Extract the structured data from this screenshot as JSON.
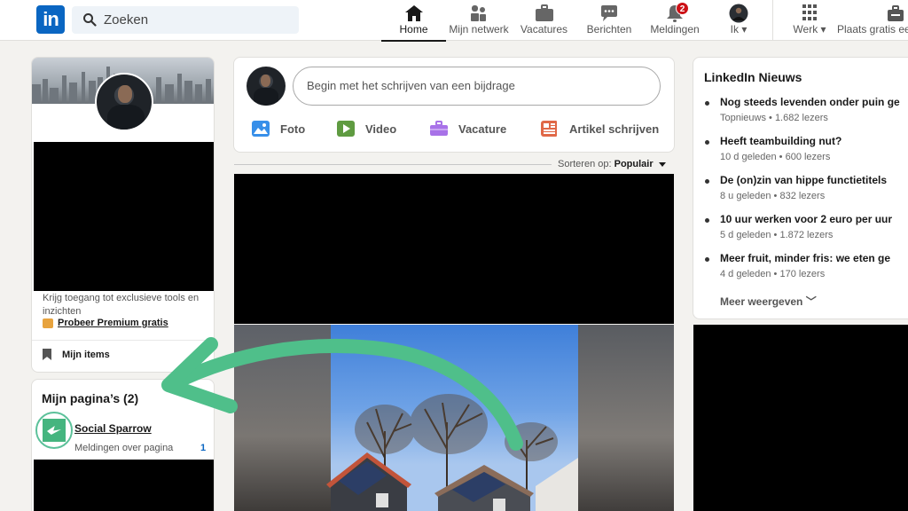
{
  "topbar": {
    "logo": "in",
    "search_placeholder": "Zoeken",
    "nav": [
      {
        "label": "Home",
        "icon": "home-icon"
      },
      {
        "label": "Mijn netwerk",
        "icon": "network-icon"
      },
      {
        "label": "Vacatures",
        "icon": "briefcase-icon"
      },
      {
        "label": "Berichten",
        "icon": "messaging-icon"
      },
      {
        "label": "Meldingen",
        "icon": "bell-icon"
      },
      {
        "label": "Ik",
        "icon": "me-avatar"
      },
      {
        "label": "Werk",
        "icon": "grid-icon"
      },
      {
        "label": "Plaats gratis ee",
        "icon": "job-post-icon"
      }
    ],
    "notifications_count": "2"
  },
  "profile": {
    "premium_text": "Krijg toegang tot exclusieve tools en inzichten",
    "premium_link": "Probeer Premium gratis",
    "my_items": "Mijn items"
  },
  "pages": {
    "title": "Mijn pagina’s (2)",
    "page_name": "Social Sparrow",
    "page_sub": "Meldingen over pagina",
    "page_count": "1"
  },
  "composer": {
    "placeholder": "Begin met het schrijven van een bijdrage",
    "actions": [
      "Foto",
      "Video",
      "Vacature",
      "Artikel schrijven"
    ]
  },
  "sort": {
    "label": "Sorteren op:",
    "value": "Populair"
  },
  "news": {
    "title": "LinkedIn Nieuws",
    "items": [
      {
        "headline": "Nog steeds levenden onder puin ge",
        "meta": "Topnieuws • 1.682 lezers"
      },
      {
        "headline": "Heeft teambuilding nut?",
        "meta": "10 d geleden • 600 lezers"
      },
      {
        "headline": "De (on)zin van hippe functietitels",
        "meta": "8 u geleden • 832 lezers"
      },
      {
        "headline": "10 uur werken voor 2 euro per uur",
        "meta": "5 d geleden • 1.872 lezers"
      },
      {
        "headline": "Meer fruit, minder fris: we eten ge",
        "meta": "4 d geleden • 170 lezers"
      }
    ],
    "more": "Meer weergeven"
  },
  "colors": {
    "brand": "#0a66c2",
    "annotation_arrow": "#4fbf8a",
    "badge": "#cc1016"
  }
}
